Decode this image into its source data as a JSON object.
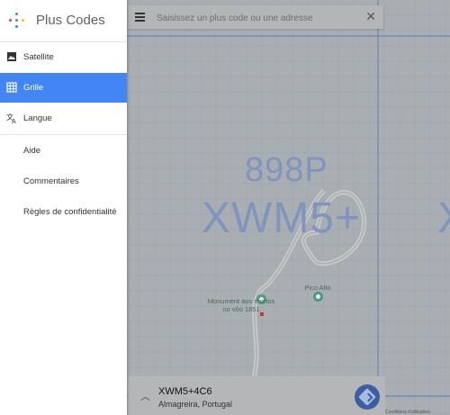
{
  "app": {
    "title": "Plus Codes",
    "logo_colors": [
      "#4285f4",
      "#ea4335",
      "#fbbc05",
      "#34a853"
    ]
  },
  "sidebar": {
    "items": [
      {
        "label": "Satellite",
        "icon": "image-icon",
        "active": false
      },
      {
        "label": "Grille",
        "icon": "grid-icon",
        "active": true
      },
      {
        "label": "Langue",
        "icon": "translate-icon",
        "active": false
      }
    ],
    "links": [
      {
        "label": "Aide"
      },
      {
        "label": "Commentaires"
      },
      {
        "label": "Règles de confidentialité"
      }
    ]
  },
  "search": {
    "placeholder": "Saisissez un plus code ou une adresse",
    "value": ""
  },
  "map": {
    "grid_code_small": "898P",
    "grid_code_big": "XWM5+",
    "grid_code_edge": "X",
    "pois": [
      {
        "name": "Monument aos mortos no vôo 1851"
      },
      {
        "name": "Pico Alto"
      }
    ]
  },
  "card": {
    "code": "XWM5+4C6",
    "location": "Almagreira, Portugal"
  },
  "footer": {
    "text": "Conditions d'utilisation"
  },
  "colors": {
    "accent": "#4285f4",
    "annotation": "#e8202a",
    "nav_button": "#3b5fa3"
  }
}
